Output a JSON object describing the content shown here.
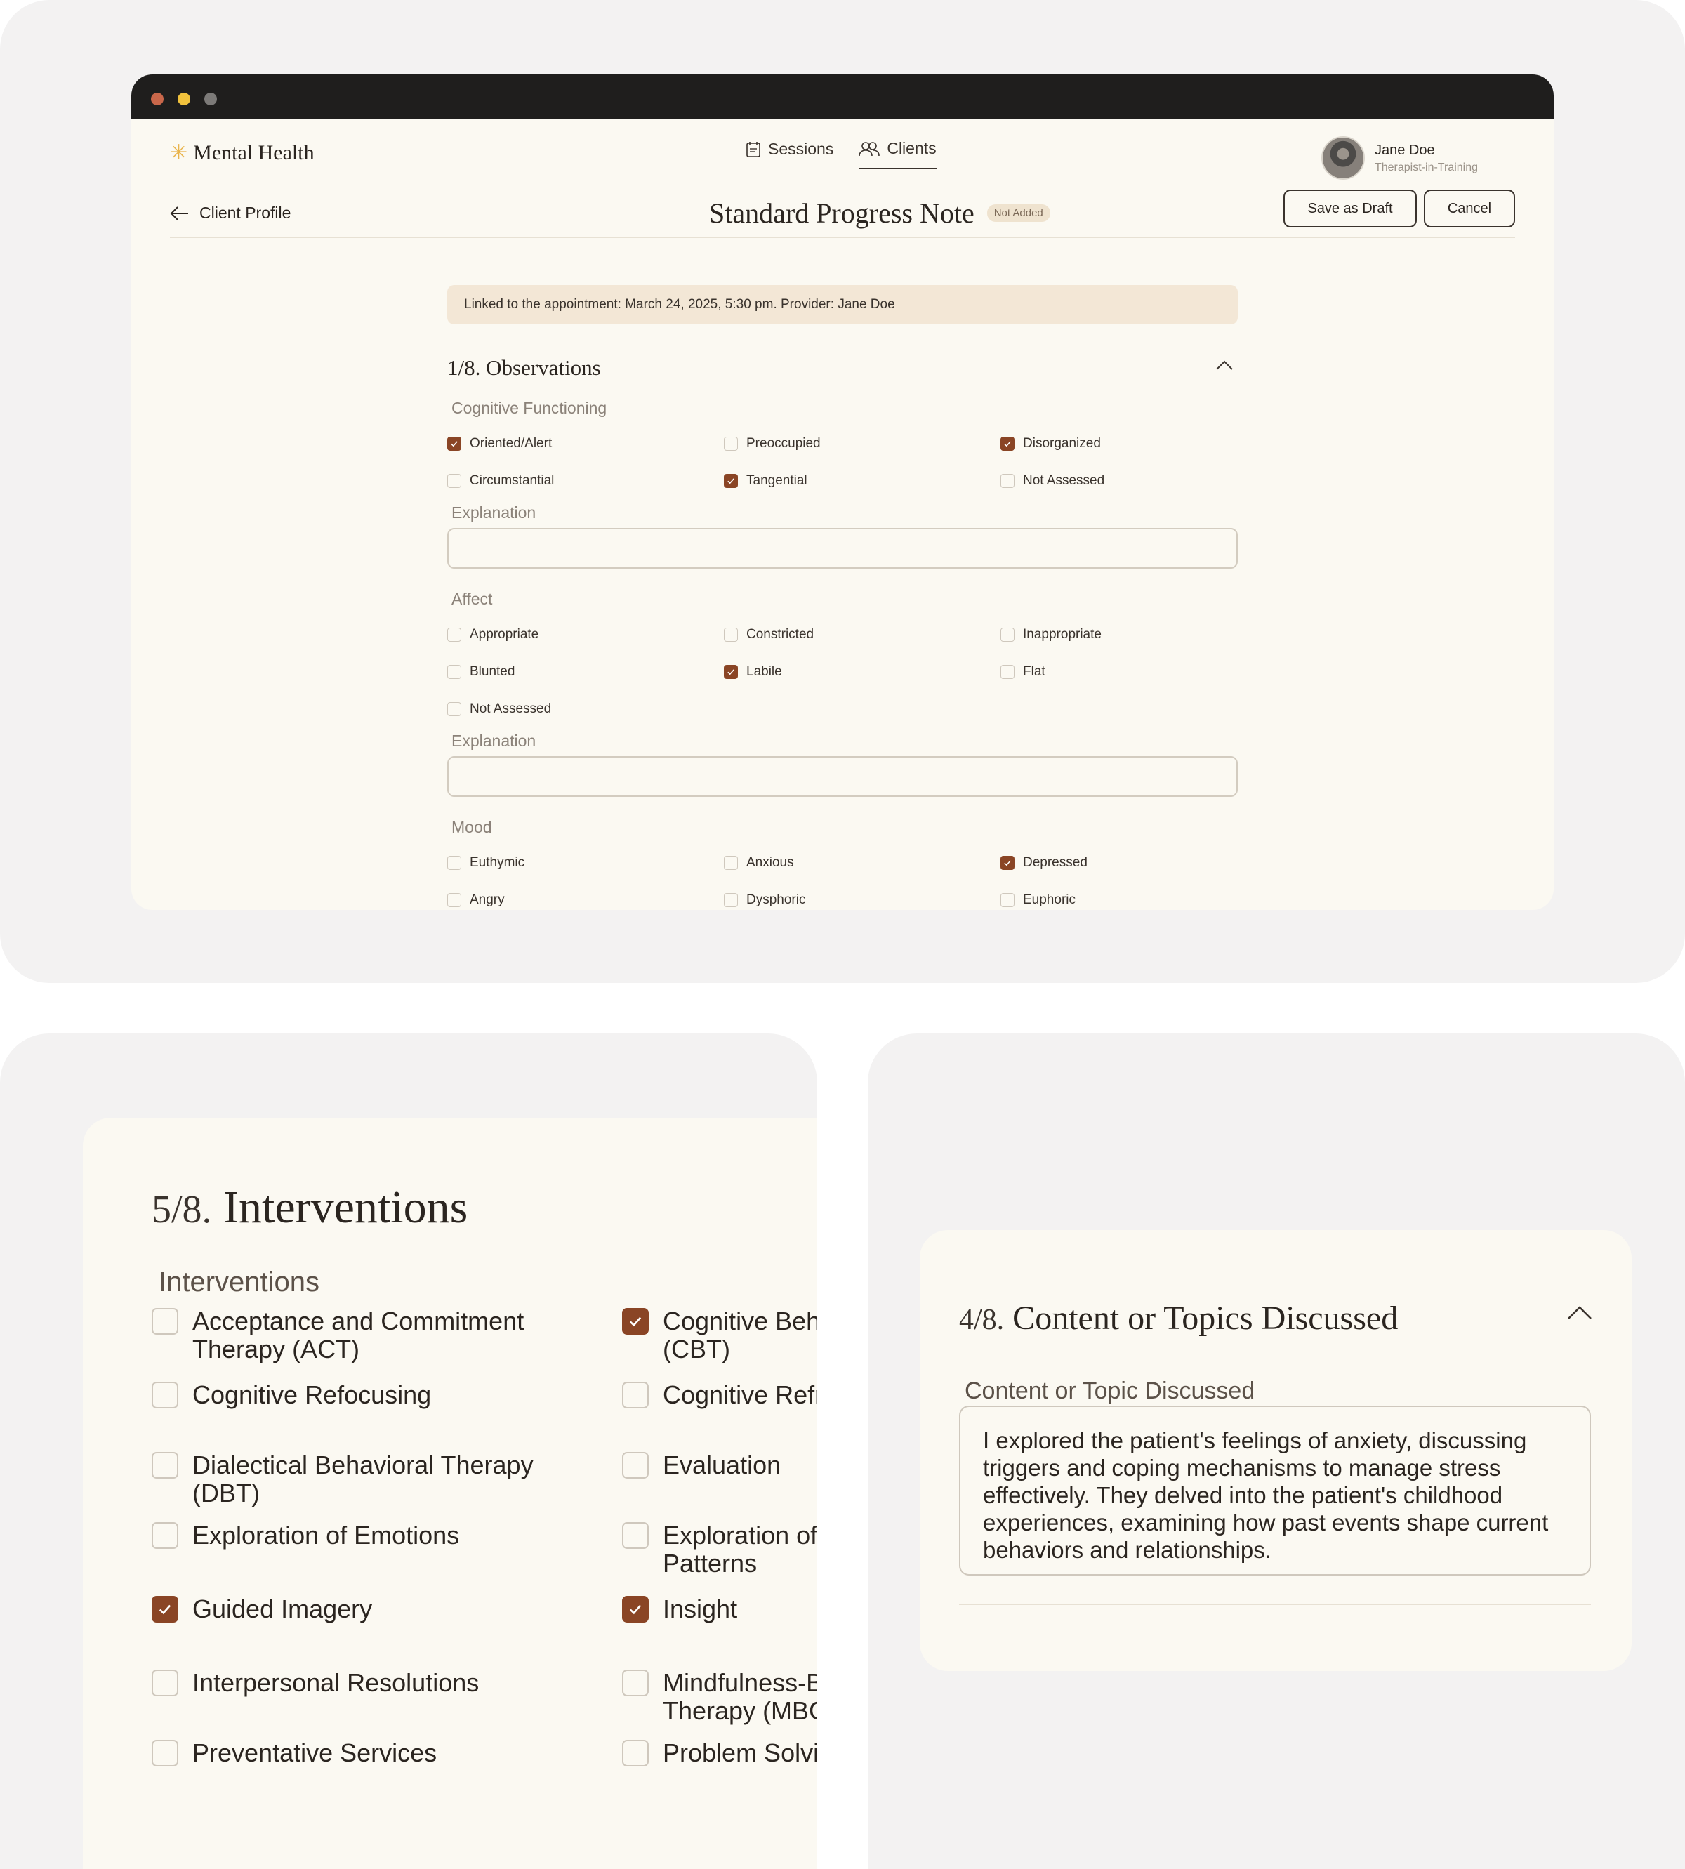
{
  "app": {
    "brand": "Mental Health",
    "nav": [
      {
        "label": "Sessions",
        "icon": "calendar-icon",
        "active": false
      },
      {
        "label": "Clients",
        "icon": "users-icon",
        "active": true
      }
    ],
    "user": {
      "name": "Jane Doe",
      "role": "Therapist-in-Training"
    }
  },
  "page": {
    "back_label": "Client Profile",
    "title": "Standard Progress Note",
    "status_badge": "Not Added",
    "save_draft": "Save as Draft",
    "cancel": "Cancel",
    "linked_text": "Linked to the appointment: March 24, 2025, 5:30 pm. Provider: Jane Doe"
  },
  "observations": {
    "title": "1/8. Observations",
    "cognitive": {
      "label": "Cognitive Functioning",
      "options": [
        {
          "label": "Oriented/Alert",
          "checked": true
        },
        {
          "label": "Preoccupied",
          "checked": false
        },
        {
          "label": "Disorganized",
          "checked": true
        },
        {
          "label": "Circumstantial",
          "checked": false
        },
        {
          "label": "Tangential",
          "checked": true
        },
        {
          "label": "Not Assessed",
          "checked": false
        }
      ],
      "explanation_label": "Explanation"
    },
    "affect": {
      "label": "Affect",
      "options": [
        {
          "label": "Appropriate",
          "checked": false
        },
        {
          "label": "Constricted",
          "checked": false
        },
        {
          "label": "Inappropriate",
          "checked": false
        },
        {
          "label": "Blunted",
          "checked": false
        },
        {
          "label": "Labile",
          "checked": true
        },
        {
          "label": "Flat",
          "checked": false
        },
        {
          "label": "Not Assessed",
          "checked": false
        }
      ],
      "explanation_label": "Explanation"
    },
    "mood": {
      "label": "Mood",
      "options": [
        {
          "label": "Euthymic",
          "checked": false
        },
        {
          "label": "Anxious",
          "checked": false
        },
        {
          "label": "Depressed",
          "checked": true
        },
        {
          "label": "Angry",
          "checked": false
        },
        {
          "label": "Dysphoric",
          "checked": false
        },
        {
          "label": "Euphoric",
          "checked": false
        }
      ]
    }
  },
  "interventions": {
    "number": "5/8.",
    "title": "Interventions",
    "group_label": "Interventions",
    "options": [
      {
        "lines": [
          "Acceptance and Commitment",
          "Therapy (ACT)"
        ],
        "checked": false
      },
      {
        "lines": [
          "Cognitive Beha",
          "(CBT)"
        ],
        "checked": true
      },
      {
        "lines": [
          "Cognitive Refocusing"
        ],
        "checked": false
      },
      {
        "lines": [
          "Cognitive Refra"
        ],
        "checked": false
      },
      {
        "lines": [
          "Dialectical Behavioral Therapy",
          "(DBT)"
        ],
        "checked": false
      },
      {
        "lines": [
          "Evaluation"
        ],
        "checked": false
      },
      {
        "lines": [
          "Exploration of Emotions"
        ],
        "checked": false
      },
      {
        "lines": [
          "Exploration of",
          "Patterns"
        ],
        "checked": false
      },
      {
        "lines": [
          "Guided Imagery"
        ],
        "checked": true
      },
      {
        "lines": [
          "Insight"
        ],
        "checked": true
      },
      {
        "lines": [
          "Interpersonal Resolutions"
        ],
        "checked": false
      },
      {
        "lines": [
          "Mindfulness-B",
          "Therapy (MBC"
        ],
        "checked": false
      },
      {
        "lines": [
          "Preventative Services"
        ],
        "checked": false
      },
      {
        "lines": [
          "Problem Solvir"
        ],
        "checked": false
      }
    ]
  },
  "content_topics": {
    "number": "4/8.",
    "title": "Content or Topics Discussed",
    "field_label": "Content or Topic Discussed",
    "text": "I explored the patient's feelings of anxiety, discussing triggers and coping mechanisms to manage stress effectively. They delved into the patient's childhood experiences, examining how past events shape current behaviors and relationships."
  },
  "colors": {
    "accent": "#8a4525",
    "card_bg": "#fbf9f2",
    "panel_bg": "#f3f2f2",
    "banner_bg": "#f3e7d6",
    "titlebar": "#1f1e1d"
  }
}
